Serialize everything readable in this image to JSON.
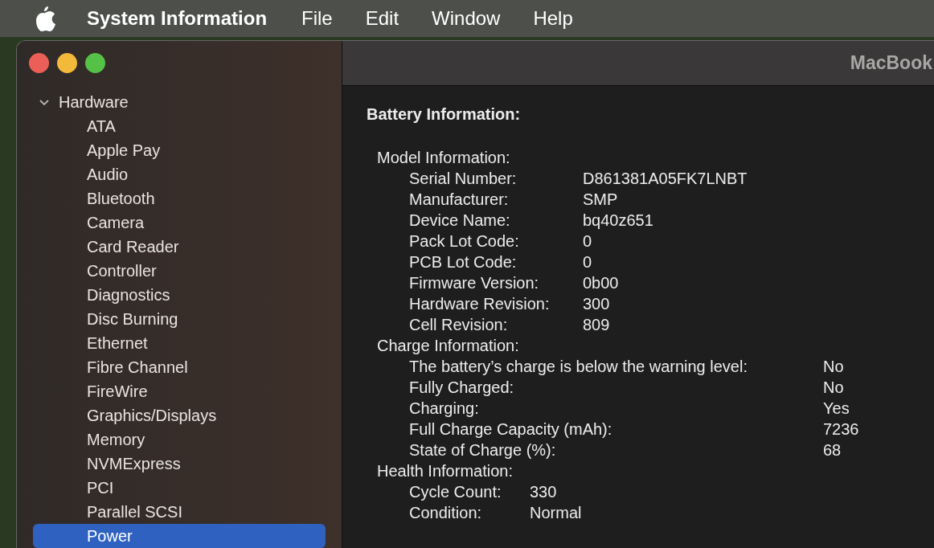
{
  "menu_bar": {
    "app_name": "System Information",
    "menus": [
      "File",
      "Edit",
      "Window",
      "Help"
    ]
  },
  "window": {
    "title": "MacBook"
  },
  "sidebar": {
    "items": [
      {
        "label": "Hardware",
        "expanded": true,
        "selected": false,
        "children": [
          {
            "label": "ATA",
            "selected": false
          },
          {
            "label": "Apple Pay",
            "selected": false
          },
          {
            "label": "Audio",
            "selected": false
          },
          {
            "label": "Bluetooth",
            "selected": false
          },
          {
            "label": "Camera",
            "selected": false
          },
          {
            "label": "Card Reader",
            "selected": false
          },
          {
            "label": "Controller",
            "selected": false
          },
          {
            "label": "Diagnostics",
            "selected": false
          },
          {
            "label": "Disc Burning",
            "selected": false
          },
          {
            "label": "Ethernet",
            "selected": false
          },
          {
            "label": "Fibre Channel",
            "selected": false
          },
          {
            "label": "FireWire",
            "selected": false
          },
          {
            "label": "Graphics/Displays",
            "selected": false
          },
          {
            "label": "Memory",
            "selected": false
          },
          {
            "label": "NVMExpress",
            "selected": false
          },
          {
            "label": "PCI",
            "selected": false
          },
          {
            "label": "Parallel SCSI",
            "selected": false
          },
          {
            "label": "Power",
            "selected": true
          }
        ]
      }
    ]
  },
  "content": {
    "heading": "Battery Information:",
    "sections": [
      {
        "title": "Model Information:",
        "rows": [
          {
            "label": "Serial Number:",
            "value": "D861381A05FK7LNBT"
          },
          {
            "label": "Manufacturer:",
            "value": "SMP"
          },
          {
            "label": "Device Name:",
            "value": "bq40z651"
          },
          {
            "label": "Pack Lot Code:",
            "value": "0"
          },
          {
            "label": "PCB Lot Code:",
            "value": "0"
          },
          {
            "label": "Firmware Version:",
            "value": "0b00"
          },
          {
            "label": "Hardware Revision:",
            "value": "300"
          },
          {
            "label": "Cell Revision:",
            "value": "809"
          }
        ]
      },
      {
        "title": "Charge Information:",
        "rows": [
          {
            "label": "The battery’s charge is below the warning level:",
            "value": "No"
          },
          {
            "label": "Fully Charged:",
            "value": "No"
          },
          {
            "label": "Charging:",
            "value": "Yes"
          },
          {
            "label": "Full Charge Capacity (mAh):",
            "value": "7236"
          },
          {
            "label": "State of Charge (%):",
            "value": "68"
          }
        ]
      },
      {
        "title": "Health Information:",
        "rows": [
          {
            "label": "Cycle Count:",
            "value": "330"
          },
          {
            "label": "Condition:",
            "value": "Normal"
          }
        ]
      }
    ]
  }
}
